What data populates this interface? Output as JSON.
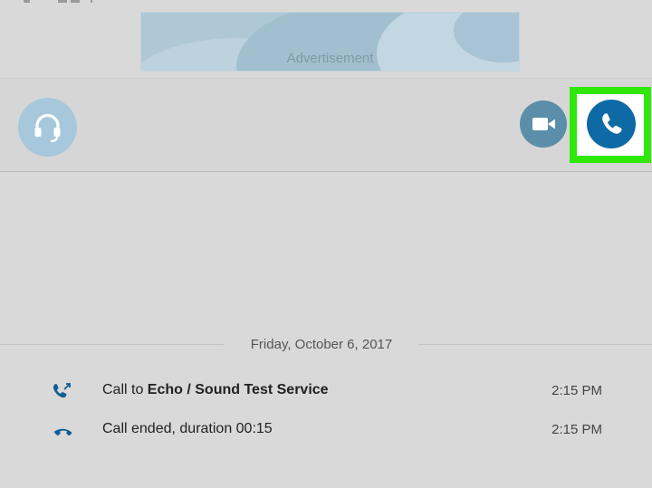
{
  "ad": {
    "label": "Advertisement"
  },
  "call_bar": {
    "headset_icon": "headset-icon",
    "video_icon": "video-camera-icon",
    "call_icon": "phone-icon",
    "highlight_color": "#2ee80a",
    "call_button_color": "#0e6aa4"
  },
  "conversation": {
    "date": "Friday, October 6, 2017",
    "entries": [
      {
        "icon": "outgoing-call-icon",
        "prefix": "Call to ",
        "contact": "Echo / Sound Test Service",
        "time": "2:15 PM"
      },
      {
        "icon": "call-ended-icon",
        "text": "Call ended, duration 00:15",
        "time": "2:15 PM"
      }
    ]
  }
}
